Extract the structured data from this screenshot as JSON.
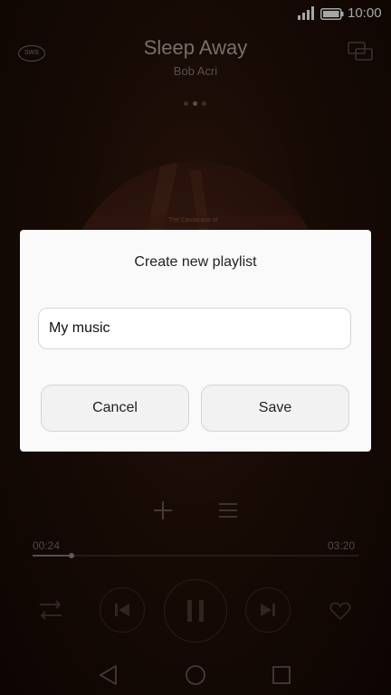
{
  "status_bar": {
    "time": "10:00"
  },
  "player": {
    "title": "Sleep Away",
    "artist": "Bob Acri",
    "sws_badge": "SWS",
    "album_label": "The Cavalcade of",
    "elapsed": "00:24",
    "duration": "03:20",
    "progress": 0.12
  },
  "dialog": {
    "title": "Create new playlist",
    "input_value": "My music",
    "cancel_label": "Cancel",
    "save_label": "Save"
  },
  "colors": {
    "dialog_bg": "#fafafa",
    "background": "#241109"
  }
}
